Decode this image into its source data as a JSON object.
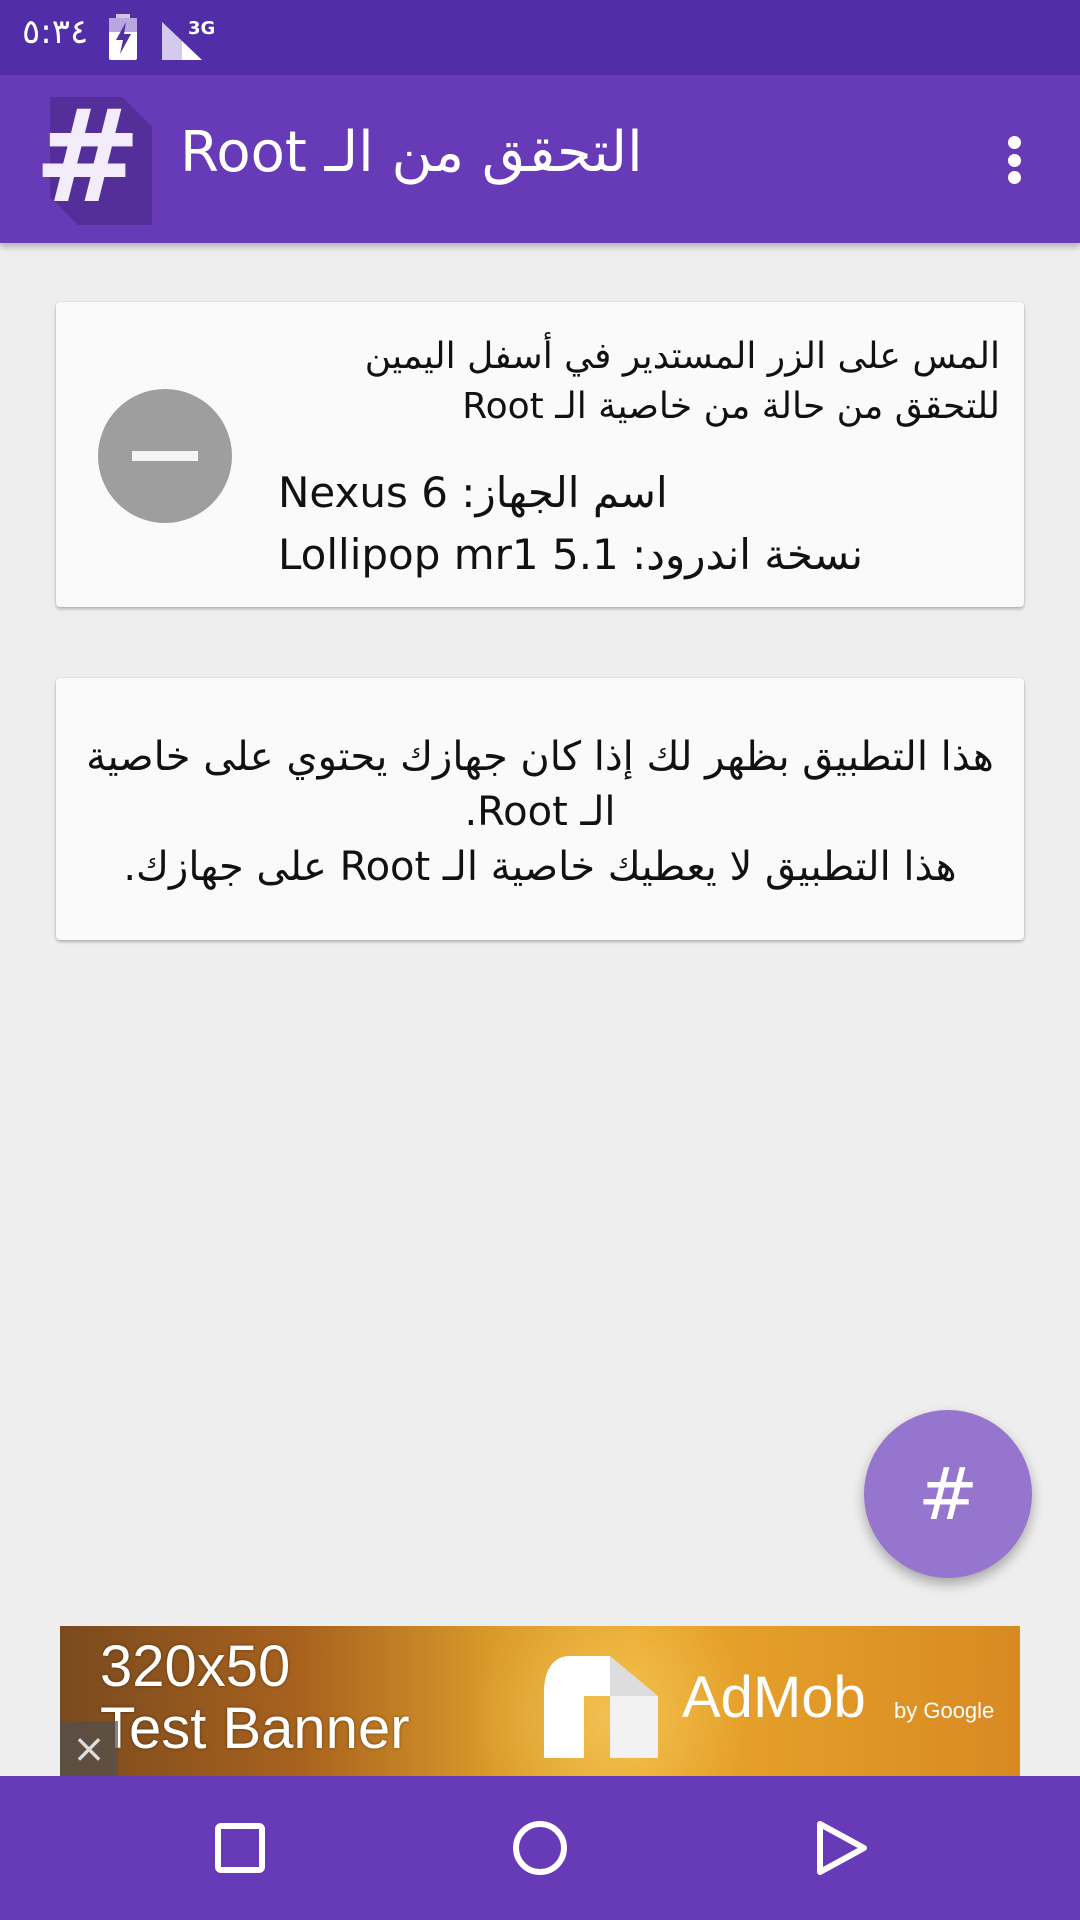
{
  "status_bar": {
    "time": "٥:٣٤",
    "network": "3G"
  },
  "app_bar": {
    "title": "التحقق من الـ Root"
  },
  "status_card": {
    "instruction": "المس على الزر المستدير في أسفل اليمين للتحقق من حالة من خاصية الـ Root",
    "device_name": "اسم الجهاز: Nexus 6",
    "android_version": "نسخة اندرود: Lollipop mr1 5.1"
  },
  "info_card": {
    "line1": "هذا التطبيق بظهر لك إذا كان جهازك يحتوي على خاصية الـ Root.",
    "line2": "هذا التطبيق لا يعطيك خاصية الـ Root على جهازك."
  },
  "fab": {
    "label": "#"
  },
  "ad": {
    "size": "320x50",
    "text": "Test Banner",
    "brand": "AdMob",
    "brand_sub": "by Google",
    "close": "×"
  },
  "colors": {
    "status_bar": "#512da8",
    "primary": "#673ab7",
    "fab": "#9575cd"
  },
  "icons": {
    "battery": "battery-charging-icon",
    "signal": "signal-icon",
    "logo": "hash-logo-icon",
    "menu": "overflow-menu-icon",
    "recent": "recent-apps-icon",
    "home": "home-icon",
    "back": "back-icon"
  }
}
